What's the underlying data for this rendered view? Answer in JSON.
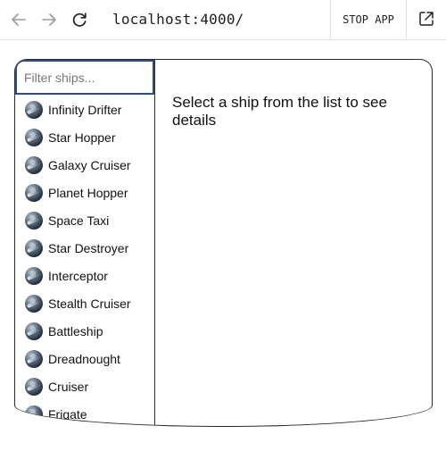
{
  "browser": {
    "url": "localhost:4000/",
    "stop_app_label": "STOP APP",
    "icons": {
      "back": "arrow-left-icon",
      "forward": "arrow-right-icon",
      "reload": "reload-icon",
      "open_external": "external-link-icon"
    }
  },
  "app": {
    "filter": {
      "placeholder": "Filter ships...",
      "value": ""
    },
    "ships": [
      "Infinity Drifter",
      "Star Hopper",
      "Galaxy Cruiser",
      "Planet Hopper",
      "Space Taxi",
      "Star Destroyer",
      "Interceptor",
      "Stealth Cruiser",
      "Battleship",
      "Dreadnought",
      "Cruiser",
      "Frigate"
    ],
    "details_prompt": "Select a ship from the list to see details"
  },
  "colors": {
    "focus_border": "#2d4e82",
    "frame_border": "#2b2b2b",
    "chrome_divider": "#e3e3e3",
    "nav_icon_disabled": "#9a9a9a"
  }
}
